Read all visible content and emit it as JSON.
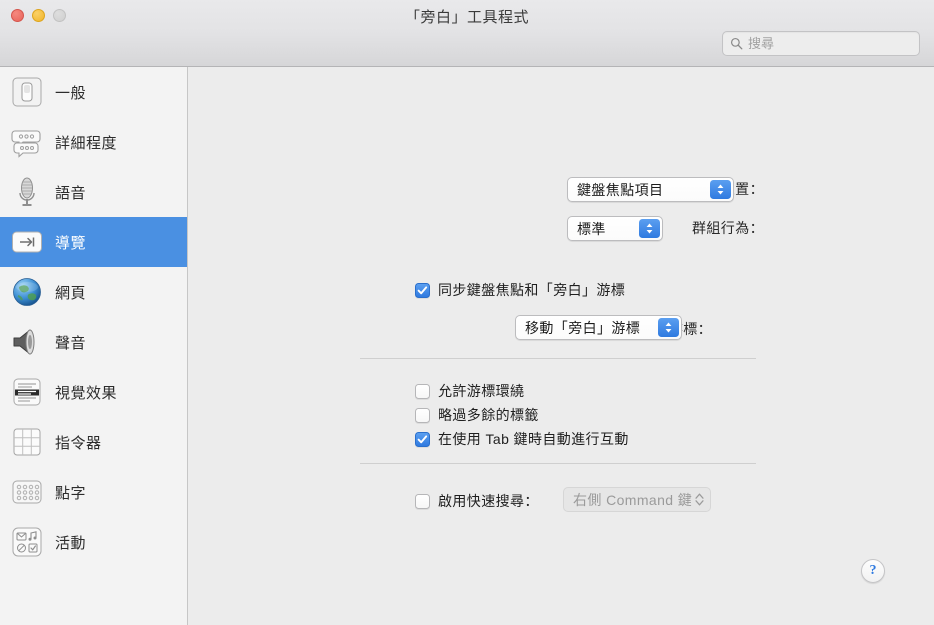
{
  "window": {
    "title": "「旁白」工具程式",
    "traffic_lights": [
      "close",
      "minimize",
      "zoom"
    ]
  },
  "search": {
    "placeholder": "搜尋",
    "value": "",
    "icon": "search-icon"
  },
  "sidebar": {
    "items": [
      {
        "label": "一般",
        "icon": "general-icon",
        "selected": false
      },
      {
        "label": "詳細程度",
        "icon": "verbosity-icon",
        "selected": false
      },
      {
        "label": "語音",
        "icon": "microphone-icon",
        "selected": false
      },
      {
        "label": "導覽",
        "icon": "tab-key-icon",
        "selected": true
      },
      {
        "label": "網頁",
        "icon": "globe-icon",
        "selected": false
      },
      {
        "label": "聲音",
        "icon": "speaker-icon",
        "selected": false
      },
      {
        "label": "視覺效果",
        "icon": "visuals-icon",
        "selected": false
      },
      {
        "label": "指令器",
        "icon": "grid-icon",
        "selected": false
      },
      {
        "label": "點字",
        "icon": "braille-icon",
        "selected": false
      },
      {
        "label": "活動",
        "icon": "activities-icon",
        "selected": false
      }
    ]
  },
  "main": {
    "initial_position": {
      "label": "「旁白」游標的初始位置：",
      "value": "鍵盤焦點項目",
      "disabled": false
    },
    "group_behavior": {
      "label": "群組行為：",
      "value": "標準",
      "disabled": false
    },
    "sync_keyboard": {
      "label": "同步鍵盤焦點和「旁白」游標",
      "checked": true
    },
    "mouse_cursor": {
      "label": "滑鼠游標：",
      "value": "移動「旁白」游標",
      "disabled": false
    },
    "allow_wrap": {
      "label": "允許游標環繞",
      "checked": false
    },
    "skip_redundant_labels": {
      "label": "略過多餘的標籤",
      "checked": false
    },
    "auto_interact_tab": {
      "label": "在使用 Tab 鍵時自動進行互動",
      "checked": true
    },
    "quick_nav": {
      "label": "啟用快速搜尋：",
      "checked": false,
      "value": "右側 Command 鍵",
      "disabled": true
    },
    "help_label": "?"
  },
  "colors": {
    "accent": "#2f7ae0",
    "selection": "#4a90e2",
    "content_bg": "#ececec",
    "sidebar_bg": "#f3f3f3"
  }
}
